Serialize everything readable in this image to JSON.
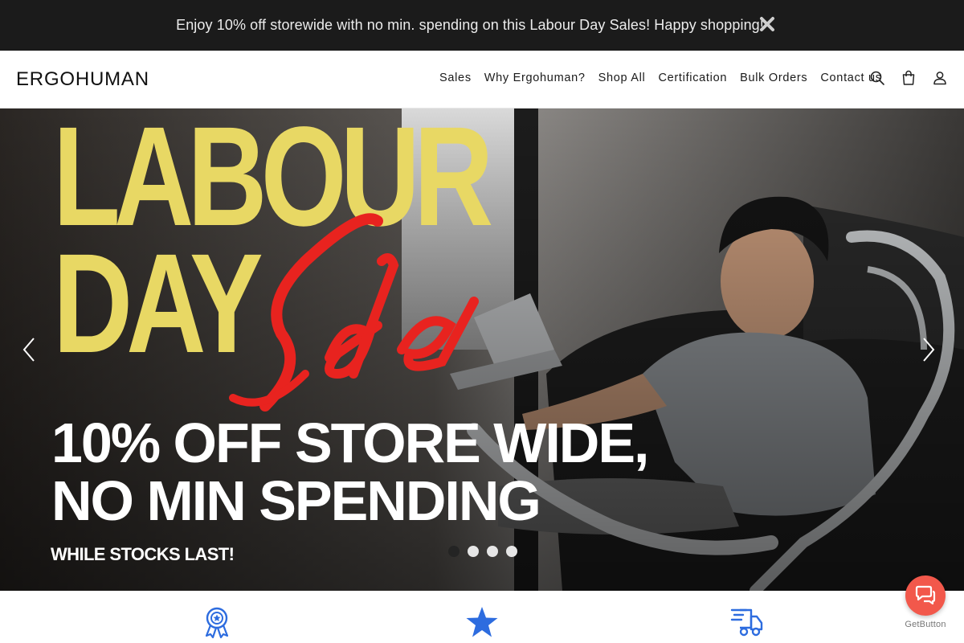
{
  "announcement": {
    "text": "Enjoy 10% off storewide with no min. spending on this Labour Day Sales! Happy shopping!",
    "close_icon": "close-icon"
  },
  "header": {
    "logo": "ERGOHUMAN",
    "nav": [
      "Sales",
      "Why Ergohuman?",
      "Shop All",
      "Certification",
      "Bulk Orders",
      "Contact us"
    ],
    "icons": [
      "search-icon",
      "cart-icon",
      "account-icon"
    ]
  },
  "hero": {
    "line_labour": "LABOUR",
    "line_day": "DAY",
    "script_word": "Sale",
    "headline_1": "10% OFF STORE WIDE,",
    "headline_2": "NO MIN SPENDING",
    "tagline": "WHILE STOCKS LAST!",
    "slide_count": 4,
    "active_slide": 1,
    "accent_yellow": "#e8d864",
    "accent_red": "#e8231f"
  },
  "features": {
    "icons": [
      "award-ribbon-icon",
      "star-icon",
      "delivery-truck-icon"
    ],
    "icon_color": "#2d6cdf"
  },
  "chat": {
    "brand": "GetButton",
    "icon": "chat-bubbles-icon",
    "color": "#f2584b"
  }
}
